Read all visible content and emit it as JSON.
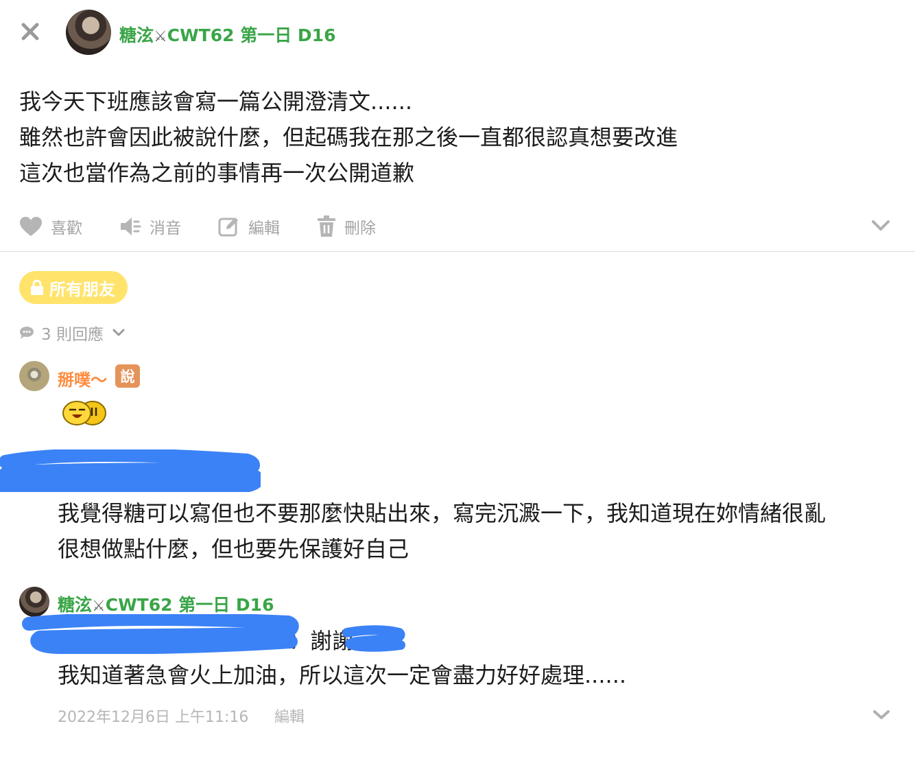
{
  "post": {
    "author": "糖泫",
    "author_badge": "CWT62 第一日 D16",
    "lines": [
      "我今天下班應該會寫一篇公開澄清文......",
      "雖然也許會因此被說什麼，但起碼我在那之後一直都很認真想要改進",
      "這次也當作為之前的事情再一次公開道歉"
    ],
    "actions": {
      "like": "喜歡",
      "mute": "消音",
      "edit": "編輯",
      "delete": "刪除"
    },
    "privacy": "所有朋友",
    "reply_count_label": "3 則回應"
  },
  "comments": [
    {
      "author": "掰噗～",
      "tag": "說",
      "sticker": "laughing-emoticon"
    },
    {
      "lines": [
        "我覺得糖可以寫但也不要那麼快貼出來，寫完沉澱一下，我知道現在妳情緒很亂",
        "很想做點什麼，但也要先保護好自己"
      ]
    },
    {
      "author": "糖泫",
      "author_badge": "CWT62 第一日 D16",
      "line1": "：謝謝",
      "line2": "我知道著急會火上加油，所以這次一定會盡力好好處理......"
    }
  ],
  "footer": {
    "timestamp": "2022年12月6日 上午11:16",
    "edit": "編輯"
  },
  "colors": {
    "author_green": "#3aa547",
    "bot_orange": "#ff8b3d",
    "privacy_yellow": "#ffe36b",
    "redaction_blue": "#3b82f6",
    "muted_gray": "#a4a4a4"
  }
}
